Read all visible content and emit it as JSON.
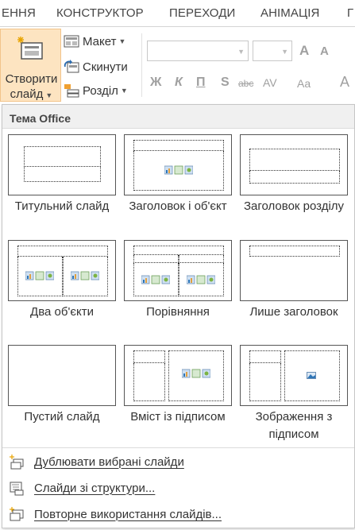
{
  "tabs": [
    "ЕННЯ",
    "КОНСТРУКТОР",
    "ПЕРЕХОДИ",
    "АНІМАЦІЯ",
    "Г"
  ],
  "ribbon": {
    "new_slide_line1": "Створити",
    "new_slide_line2": "слайд",
    "layout_label": "Макет",
    "reset_label": "Скинути",
    "section_label": "Розділ",
    "format_bold": "Ж",
    "format_italic": "К",
    "format_underline": "П",
    "format_shadow": "S",
    "format_strike": "abc",
    "format_spacing": "AV",
    "format_case": "Aa",
    "grow_font": "A",
    "shrink_font": "A",
    "font_color": "A"
  },
  "gallery": {
    "title": "Тема Office",
    "layouts": [
      {
        "label": "Титульний слайд"
      },
      {
        "label": "Заголовок і об'єкт"
      },
      {
        "label": "Заголовок розділу"
      },
      {
        "label": "Два об'єкти"
      },
      {
        "label": "Порівняння"
      },
      {
        "label": "Лише заголовок"
      },
      {
        "label": "Пустий слайд"
      },
      {
        "label": "Вміст із підписом"
      },
      {
        "label": "Зображення з підписом"
      }
    ]
  },
  "menu": {
    "duplicate": "Дублювати вибрані слайди",
    "outline": "Слайди зі структури...",
    "reuse": "Повторне використання слайдів..."
  },
  "colors": {
    "accent_bg": "#fde4c1",
    "accent_border": "#f2c48a"
  }
}
